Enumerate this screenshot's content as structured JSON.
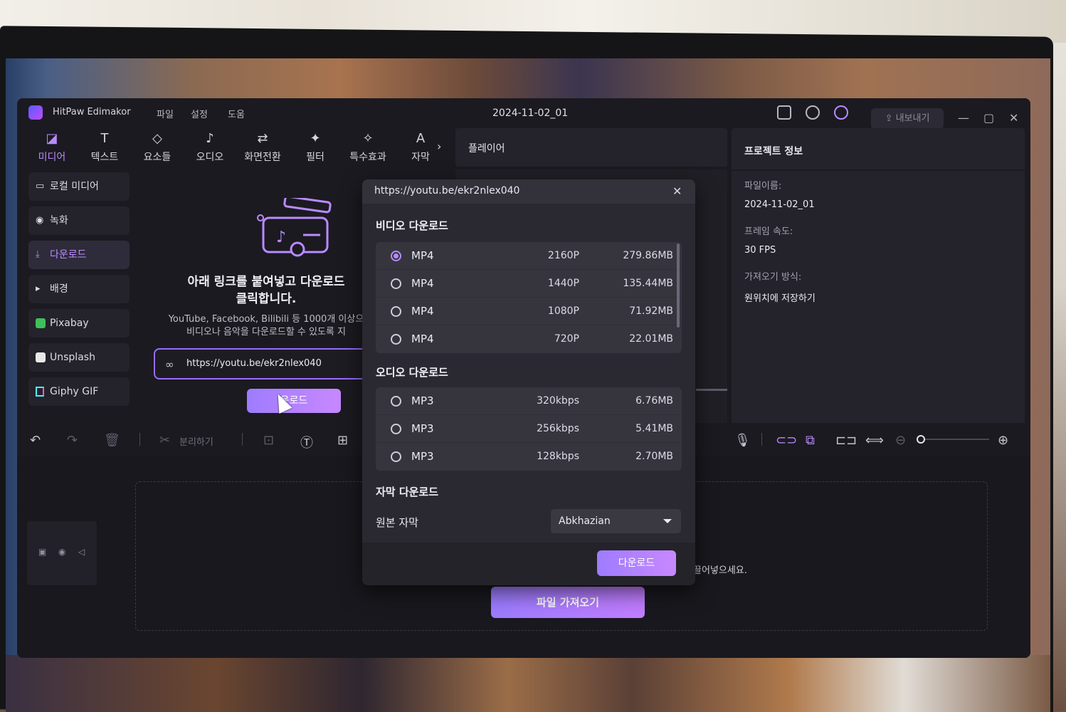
{
  "app": {
    "name": "HitPaw Edimakor",
    "menus": [
      "파일",
      "설정",
      "도움"
    ],
    "document_title": "2024-11-02_01",
    "export_label": "내보내기"
  },
  "toolbar": {
    "tabs": [
      {
        "label": "미디어",
        "icon": "media-icon",
        "active": true
      },
      {
        "label": "텍스트",
        "icon": "text-icon"
      },
      {
        "label": "요소들",
        "icon": "elements-icon"
      },
      {
        "label": "오디오",
        "icon": "music-icon"
      },
      {
        "label": "화면전환",
        "icon": "transition-icon"
      },
      {
        "label": "필터",
        "icon": "filter-icon"
      },
      {
        "label": "특수효과",
        "icon": "effects-icon"
      },
      {
        "label": "자막",
        "icon": "subtitle-icon"
      }
    ]
  },
  "sidebar": {
    "items": [
      {
        "label": "로컬 미디어",
        "icon": "folder-icon"
      },
      {
        "label": "녹화",
        "icon": "record-icon"
      },
      {
        "label": "다운로드",
        "icon": "download-icon",
        "active": true
      },
      {
        "label": "배경",
        "icon": "caret-right-icon"
      },
      {
        "label": "Pixabay",
        "icon": "pixabay-icon"
      },
      {
        "label": "Unsplash",
        "icon": "unsplash-icon"
      },
      {
        "label": "Giphy GIF",
        "icon": "giphy-icon"
      }
    ]
  },
  "download_panel": {
    "title_line1": "아래 링크를 붙여넣고 다운로드",
    "title_line2": "클릭합니다.",
    "desc_line1": "YouTube, Facebook, Bilibili 등 1000개 이상으",
    "desc_line2": "비디오나 음악을 다운로드할 수 있도록 지",
    "url_value": "https://youtu.be/ekr2nlex040",
    "button_label": "운로드"
  },
  "player": {
    "title": "플레이어"
  },
  "project_info": {
    "title": "프로젝트 정보",
    "filename_label": "파일이름:",
    "filename_value": "2024-11-02_01",
    "framerate_label": "프레임 속도:",
    "framerate_value": "30 FPS",
    "import_label": "가져오기 방식:",
    "import_value": "원위치에 저장하기"
  },
  "edit_toolbar": {
    "split_label": "분리하기"
  },
  "timeline": {
    "drop_hint": "끌어넣으세요.",
    "import_button": "파일 가져오기"
  },
  "modal": {
    "url": "https://youtu.be/ekr2nlex040",
    "video_section": "비디오 다운로드",
    "video_options": [
      {
        "format": "MP4",
        "quality": "2160P",
        "size": "279.86MB",
        "selected": true
      },
      {
        "format": "MP4",
        "quality": "1440P",
        "size": "135.44MB"
      },
      {
        "format": "MP4",
        "quality": "1080P",
        "size": "71.92MB"
      },
      {
        "format": "MP4",
        "quality": "720P",
        "size": "22.01MB"
      }
    ],
    "audio_section": "오디오 다운로드",
    "audio_options": [
      {
        "format": "MP3",
        "quality": "320kbps",
        "size": "6.76MB"
      },
      {
        "format": "MP3",
        "quality": "256kbps",
        "size": "5.41MB"
      },
      {
        "format": "MP3",
        "quality": "128kbps",
        "size": "2.70MB"
      }
    ],
    "subtitle_section": "자막 다운로드",
    "subtitle_label": "원본 자막",
    "subtitle_language": "Abkhazian",
    "download_button": "다운로드"
  },
  "colors": {
    "accent": "#b98bff",
    "button_gradient_start": "#9e7cff",
    "button_gradient_end": "#c888ff"
  }
}
